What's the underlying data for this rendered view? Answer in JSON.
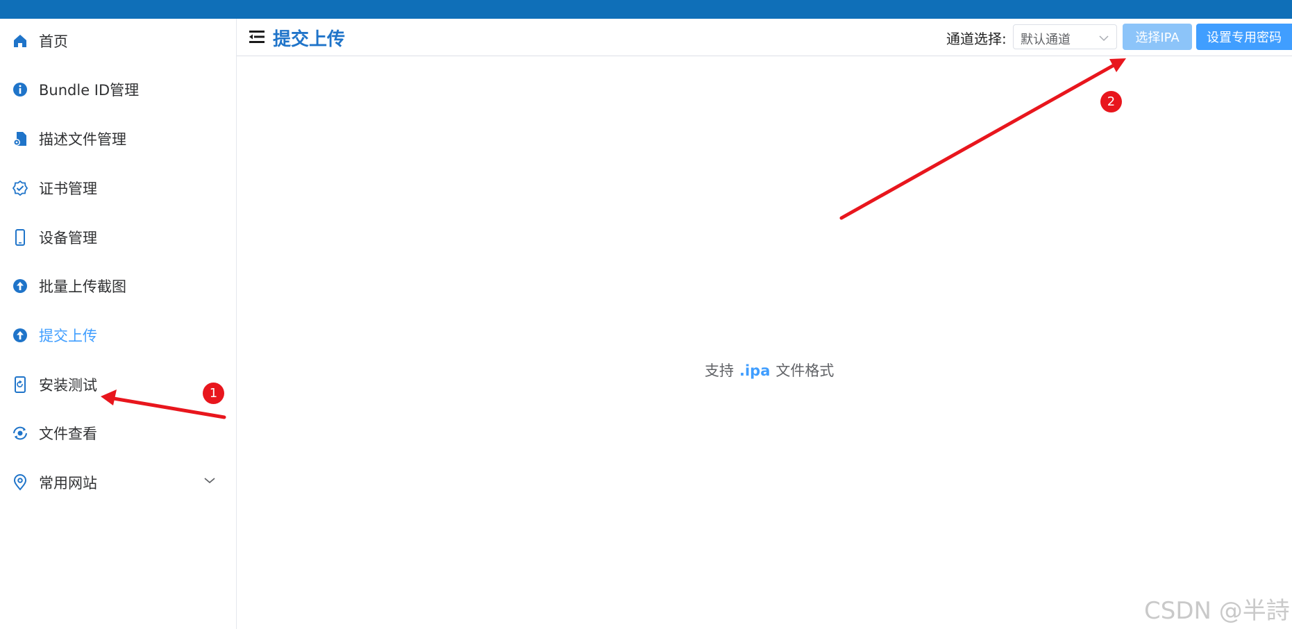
{
  "sidebar": {
    "items": [
      {
        "label": "首页",
        "icon": "home-icon"
      },
      {
        "label": "Bundle ID管理",
        "icon": "info-icon"
      },
      {
        "label": "描述文件管理",
        "icon": "file-gear-icon"
      },
      {
        "label": "证书管理",
        "icon": "certificate-icon"
      },
      {
        "label": "设备管理",
        "icon": "phone-icon"
      },
      {
        "label": "批量上传截图",
        "icon": "upload-circle-icon"
      },
      {
        "label": "提交上传",
        "icon": "upload-circle-icon",
        "active": true
      },
      {
        "label": "安装测试",
        "icon": "install-icon"
      },
      {
        "label": "文件查看",
        "icon": "eye-cycle-icon"
      },
      {
        "label": "常用网站",
        "icon": "location-icon",
        "expandable": true
      }
    ]
  },
  "header": {
    "title": "提交上传",
    "channel_label": "通道选择:",
    "channel_value": "默认通道",
    "select_ipa_button": "选择IPA",
    "set_password_button": "设置专用密码"
  },
  "main": {
    "hint_prefix": "支持",
    "hint_ext": ".ipa",
    "hint_suffix": "文件格式"
  },
  "annotations": {
    "badge_1": "1",
    "badge_2": "2"
  },
  "watermark": "CSDN @半詩",
  "colors": {
    "topbar": "#0f6fb8",
    "accent": "#409eff",
    "title": "#1f74c9",
    "arrow": "#e8161d"
  }
}
